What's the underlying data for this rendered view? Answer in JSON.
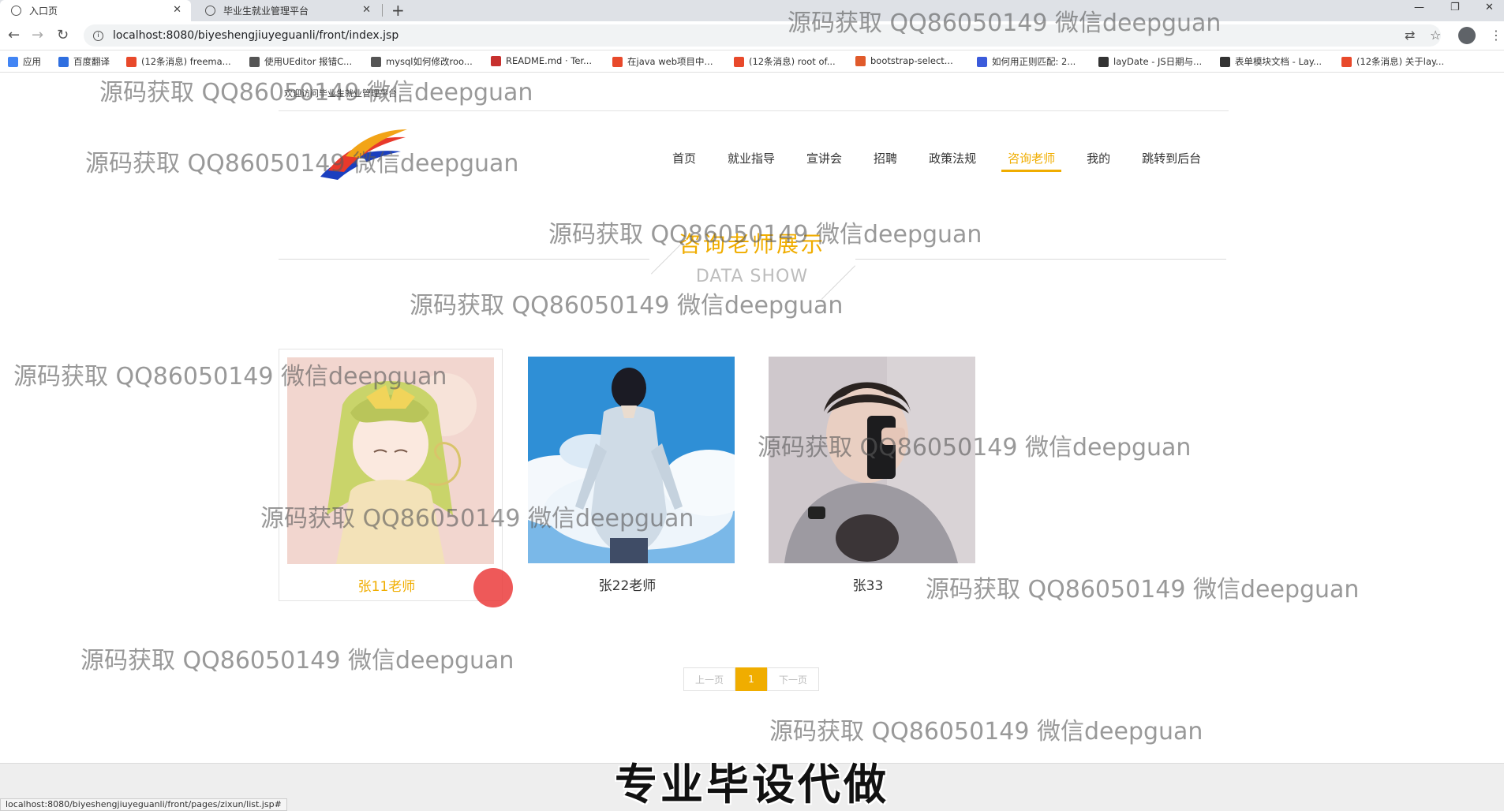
{
  "browser": {
    "tabs": [
      {
        "title": "入口页",
        "active": true
      },
      {
        "title": "毕业生就业管理平台",
        "active": false
      }
    ],
    "url": "localhost:8080/biyeshengjiuyeguanli/front/index.jsp",
    "bookmarks": [
      {
        "label": "应用",
        "color": "#4285f4"
      },
      {
        "label": "百度翻译",
        "color": "#2f6fe0"
      },
      {
        "label": "(12条消息) freema...",
        "color": "#e8492b"
      },
      {
        "label": "使用UEditor 报错C...",
        "color": "#555555"
      },
      {
        "label": "mysql如何修改roo...",
        "color": "#555555"
      },
      {
        "label": "README.md · Ter...",
        "color": "#c7302e"
      },
      {
        "label": "在java web项目中...",
        "color": "#e8492b"
      },
      {
        "label": "(12条消息) root of...",
        "color": "#e8492b"
      },
      {
        "label": "bootstrap-select...",
        "color": "#e05a2b"
      },
      {
        "label": "如何用正则匹配: 2...",
        "color": "#3b5bdb"
      },
      {
        "label": "layDate - JS日期与...",
        "color": "#333333"
      },
      {
        "label": "表单模块文档 - Lay...",
        "color": "#333333"
      },
      {
        "label": "(12条消息) 关于lay...",
        "color": "#e8492b"
      }
    ],
    "status_url": "localhost:8080/biyeshengjiuyeguanli/front/pages/zixun/list.jsp#"
  },
  "header": {
    "welcome": "欢迎访问毕业生就业管理平台"
  },
  "nav": {
    "items": [
      {
        "label": "首页",
        "active": false
      },
      {
        "label": "就业指导",
        "active": false
      },
      {
        "label": "宣讲会",
        "active": false
      },
      {
        "label": "招聘",
        "active": false
      },
      {
        "label": "政策法规",
        "active": false
      },
      {
        "label": "咨询老师",
        "active": true
      },
      {
        "label": "我的",
        "active": false
      },
      {
        "label": "跳转到后台",
        "active": false
      }
    ]
  },
  "section": {
    "title": "咨询老师展示",
    "subtitle": "DATA SHOW"
  },
  "teachers": [
    {
      "name": "张11老师",
      "highlighted": true
    },
    {
      "name": "张22老师",
      "highlighted": false
    },
    {
      "name": "张33",
      "highlighted": false
    }
  ],
  "pager": {
    "prev": "上一页",
    "current": "1",
    "next": "下一页"
  },
  "watermark": "源码获取 QQ86050149 微信deepguan",
  "promo": "专业毕设代做",
  "colors": {
    "accent": "#f0ad00"
  }
}
